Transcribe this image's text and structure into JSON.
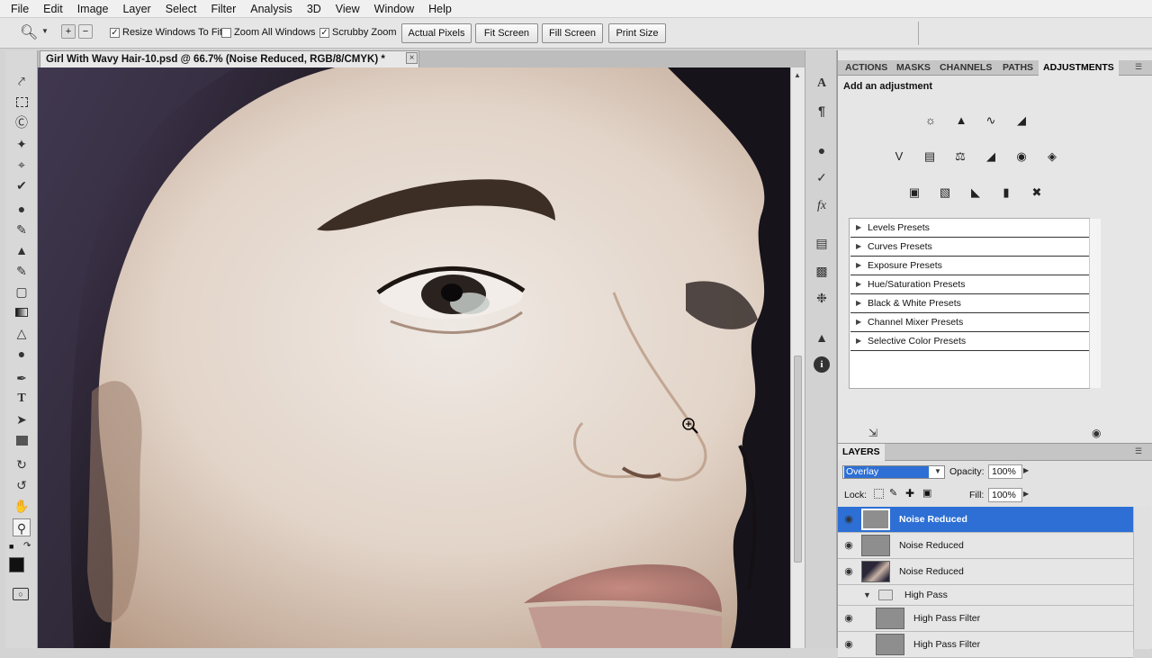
{
  "menu": [
    "File",
    "Edit",
    "Image",
    "Layer",
    "Select",
    "Filter",
    "Analysis",
    "3D",
    "View",
    "Window",
    "Help"
  ],
  "options": {
    "resize_windows": "Resize Windows To Fit",
    "zoom_all": "Zoom All Windows",
    "scrubby": "Scrubby Zoom",
    "actual_pixels": "Actual Pixels",
    "fit_screen": "Fit Screen",
    "fill_screen": "Fill Screen",
    "print_size": "Print Size"
  },
  "document": {
    "tab_title": "Girl With Wavy Hair-10.psd @ 66.7% (Noise Reduced, RGB/8/CMYK) *",
    "close": "×"
  },
  "panel_tabs": [
    "ACTIONS",
    "MASKS",
    "CHANNELS",
    "PATHS",
    "ADJUSTMENTS"
  ],
  "adjustments": {
    "heading": "Add an adjustment",
    "presets": [
      "Levels Presets",
      "Curves Presets",
      "Exposure Presets",
      "Hue/Saturation Presets",
      "Black & White Presets",
      "Channel Mixer Presets",
      "Selective Color Presets"
    ]
  },
  "layers": {
    "title": "LAYERS",
    "blend_mode": "Overlay",
    "opacity_label": "Opacity:",
    "opacity_value": "100%",
    "lock_label": "Lock:",
    "fill_label": "Fill:",
    "fill_value": "100%",
    "rows": [
      {
        "name": "Noise Reduced"
      },
      {
        "name": "Noise Reduced"
      },
      {
        "name": "Noise Reduced"
      },
      {
        "name": "High Pass"
      },
      {
        "name": "High Pass Filter"
      },
      {
        "name": "High Pass Filter"
      }
    ]
  },
  "colors": {
    "selection": "#2d6fd4",
    "chrome": "#e6e6e6"
  }
}
